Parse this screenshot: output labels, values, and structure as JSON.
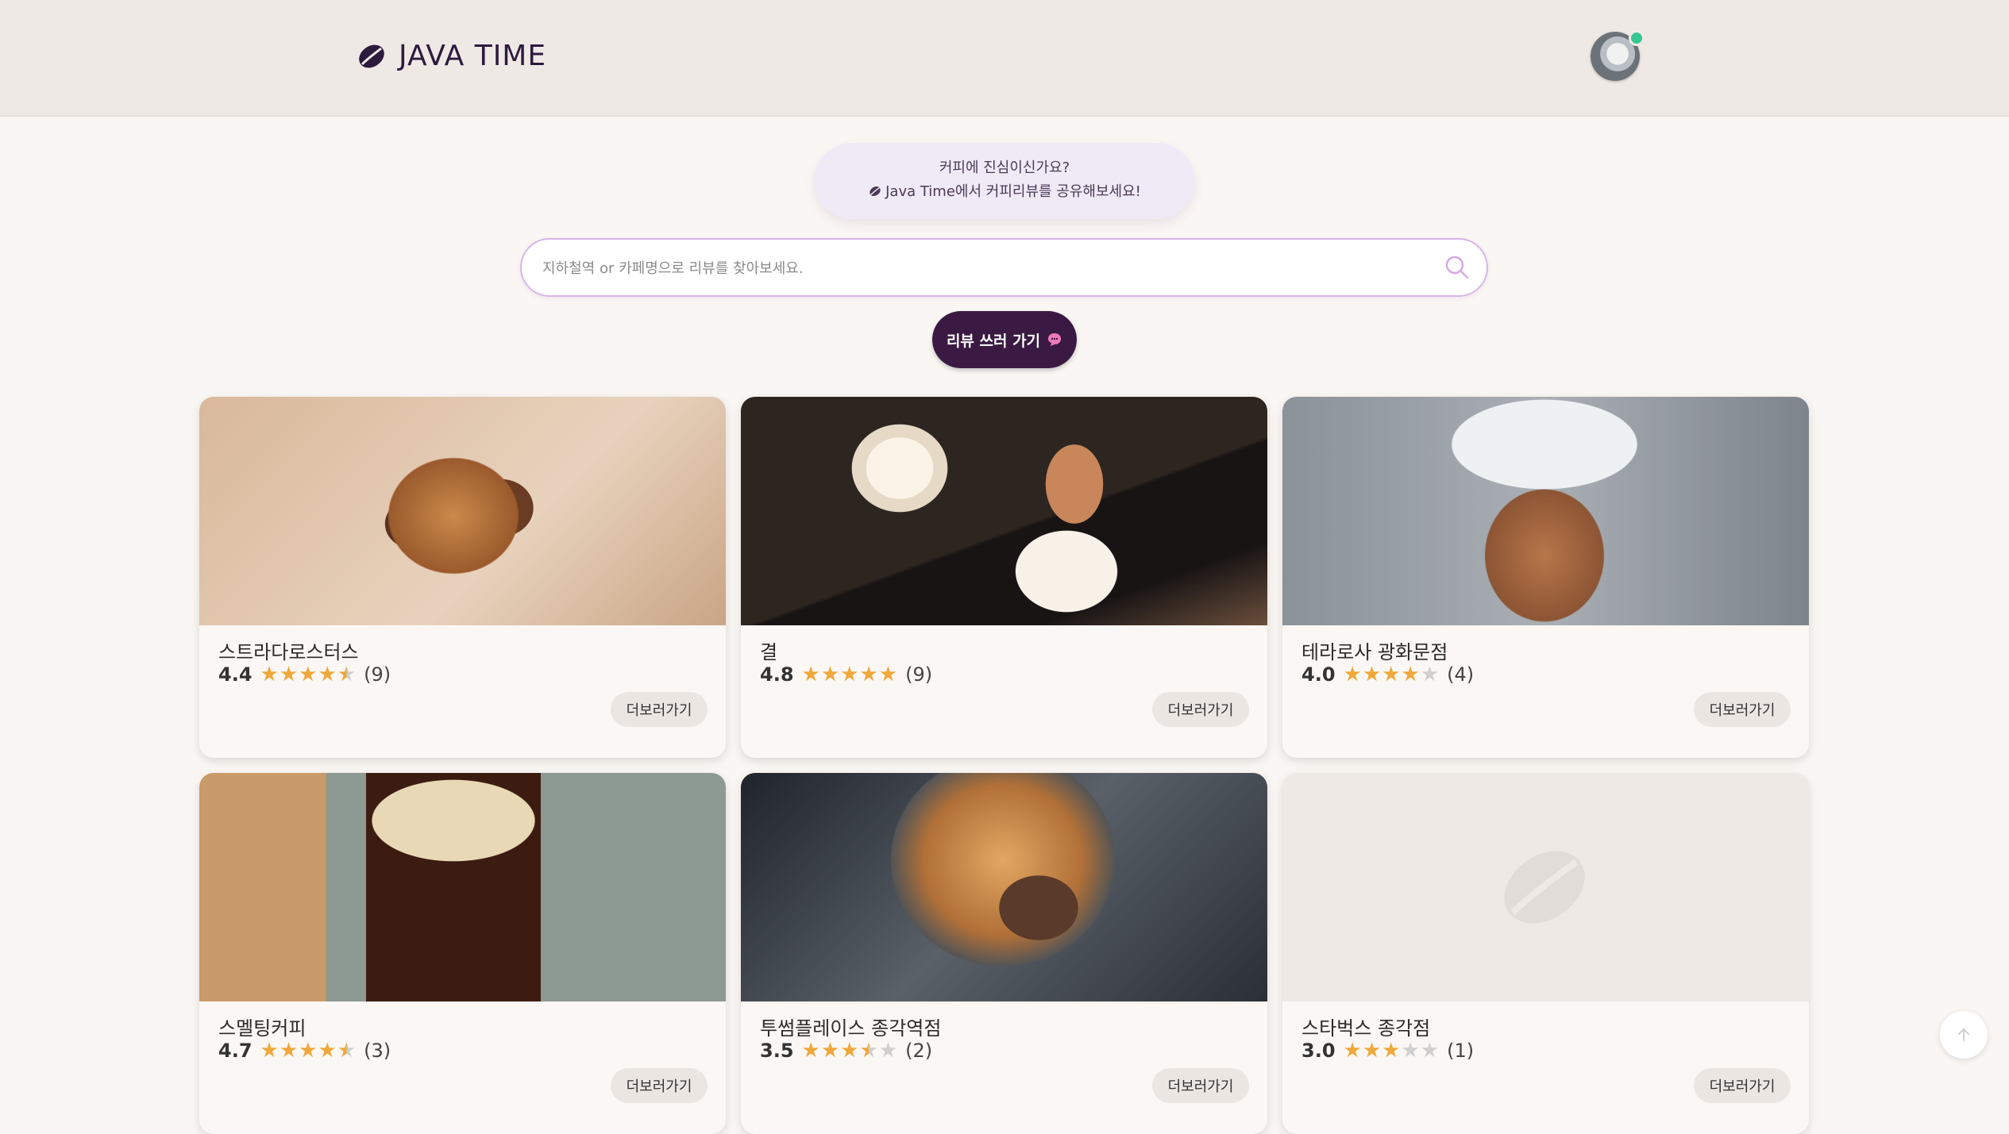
{
  "header": {
    "brand": "JAVA TIME",
    "logo_icon": "coffee-bean-icon",
    "avatar_icon": "user-avatar"
  },
  "banner": {
    "line1": "커피에 진심이신가요?",
    "line2": "Java Time에서 커피리뷰를 공유해보세요!"
  },
  "search": {
    "placeholder": "지하철역 or 카페명으로 리뷰를 찾아보세요.",
    "value": ""
  },
  "write_button": {
    "label": "리뷰 쓰러 가기"
  },
  "cards": [
    {
      "name": "스트라다로스터스",
      "score": "4.4",
      "rating": 4.4,
      "count": "(9)",
      "more": "더보러가기"
    },
    {
      "name": "결",
      "score": "4.8",
      "rating": 4.8,
      "count": "(9)",
      "more": "더보러가기"
    },
    {
      "name": "테라로사 광화문점",
      "score": "4.0",
      "rating": 4.0,
      "count": "(4)",
      "more": "더보러가기"
    },
    {
      "name": "스멜팅커피",
      "score": "4.7",
      "rating": 4.7,
      "count": "(3)",
      "more": "더보러가기"
    },
    {
      "name": "투썸플레이스 종각역점",
      "score": "3.5",
      "rating": 3.5,
      "count": "(2)",
      "more": "더보러가기"
    },
    {
      "name": "스타벅스 종각점",
      "score": "3.0",
      "rating": 3.0,
      "count": "(1)",
      "more": "더보러가기"
    }
  ],
  "colors": {
    "accent": "#3a1a43",
    "star": "#f0a83a",
    "star_empty": "#cfcfcf"
  }
}
